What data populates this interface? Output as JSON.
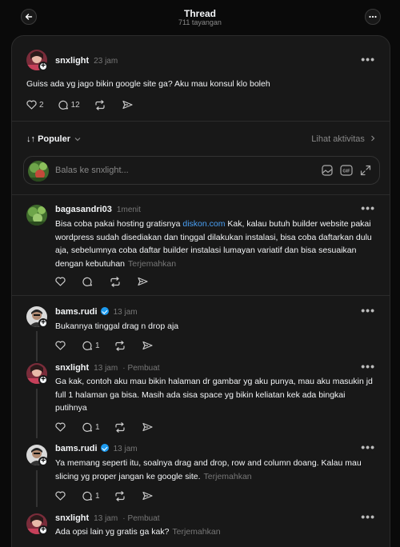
{
  "header": {
    "title": "Thread",
    "views": "711 tayangan"
  },
  "post": {
    "username": "snxlight",
    "time": "23 jam",
    "text": "Guiss ada yg jago bikin google site ga? Aku mau konsul klo boleh",
    "likes": "2",
    "replies": "12"
  },
  "sort": {
    "label": "Populer",
    "activity": "Lihat aktivitas"
  },
  "reply_box": {
    "placeholder": "Balas ke snxlight..."
  },
  "comments": [
    {
      "username": "bagasandri03",
      "time": "1menit",
      "text_before_link": "Bisa coba pakai hosting gratisnya ",
      "link": "diskon.com",
      "text_after_link": " Kak, kalau butuh builder website pakai wordpress sudah disediakan dan tinggal dilakukan instalasi, bisa coba daftarkan dulu aja, sebelumnya coba daftar builder instalasi lumayan variatif dan bisa sesuaikan dengan kebutuhan",
      "translate": "Terjemahkan"
    },
    {
      "username": "bams.rudi",
      "time": "13 jam",
      "text": "Bukannya tinggal drag n drop aja",
      "replies": "1"
    },
    {
      "username": "snxlight",
      "time": "13 jam",
      "creator": "Pembuat",
      "text": "Ga kak, contoh aku mau bikin halaman dr gambar yg aku punya, mau aku masukin jd full 1 halaman ga bisa. Masih ada sisa space yg bikin keliatan kek ada bingkai putihnya",
      "replies": "1"
    },
    {
      "username": "bams.rudi",
      "time": "13 jam",
      "text": "Ya memang seperti itu, soalnya drag and drop, row and column doang. Kalau mau slicing yg proper jangan ke google site.",
      "translate": "Terjemahkan",
      "replies": "1"
    },
    {
      "username": "snxlight",
      "time": "13 jam",
      "creator": "Pembuat",
      "text": "Ada opsi lain yg gratis ga kak?",
      "translate": "Terjemahkan"
    }
  ]
}
